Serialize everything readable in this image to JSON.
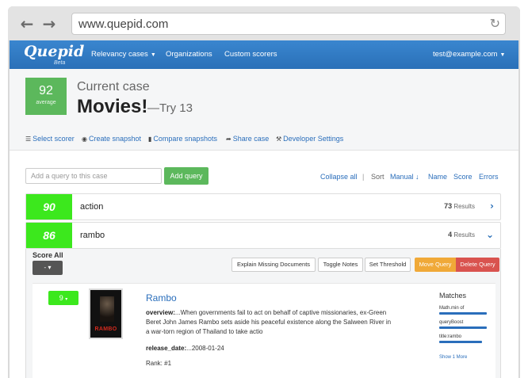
{
  "browser": {
    "url": "www.quepid.com",
    "back_icon": "←",
    "forward_icon": "→",
    "reload_icon": "↻"
  },
  "navbar": {
    "logo": "Quepid",
    "logo_sub": "Beta",
    "items": [
      {
        "label": "Relevancy cases",
        "dropdown": true
      },
      {
        "label": "Organizations",
        "dropdown": false
      },
      {
        "label": "Custom scorers",
        "dropdown": false
      }
    ],
    "user": "test@example.com"
  },
  "case": {
    "score": "92",
    "score_label": "average",
    "current_case_label": "Current case",
    "title": "Movies!",
    "try_label": "—Try 13",
    "actions": [
      {
        "label": "Select scorer",
        "icon": "list-icon"
      },
      {
        "label": "Create snapshot",
        "icon": "camera-icon"
      },
      {
        "label": "Compare snapshots",
        "icon": "bar-chart-icon"
      },
      {
        "label": "Share case",
        "icon": "share-icon"
      },
      {
        "label": "Developer Settings",
        "icon": "wrench-icon"
      }
    ]
  },
  "query_bar": {
    "placeholder": "Add a query to this case",
    "add_label": "Add query",
    "collapse_all": "Collapse all",
    "sort_label": "Sort",
    "sort_options": [
      "Manual",
      "Name",
      "Score",
      "Errors"
    ]
  },
  "queries": [
    {
      "score": "90",
      "label": "action",
      "count": "73",
      "results_label": "Results",
      "expanded": false
    },
    {
      "score": "86",
      "label": "rambo",
      "count": "4",
      "results_label": "Results",
      "expanded": true
    }
  ],
  "query_detail": {
    "score_all_label": "Score All",
    "score_all_value": "-",
    "buttons": {
      "explain": "Explain Missing Documents",
      "toggle_notes": "Toggle Notes",
      "set_threshold": "Set Threshold",
      "move_query": "Move Query",
      "delete_query": "Delete Query"
    },
    "doc": {
      "score": "9",
      "title": "Rambo",
      "poster_text": "RAMBO",
      "overview_label": "overview:",
      "overview": "...When governments fail to act on behalf of captive missionaries, ex-Green Beret John James Rambo sets aside his peaceful existence along the Salween River in a war-torn region of Thailand to take actio",
      "release_label": "release_date:",
      "release": "...2008-01-24",
      "rank": "Rank: #1",
      "matches_title": "Matches",
      "matches": [
        {
          "label": "Math.min of",
          "fill": 1.0
        },
        {
          "label": "queryBoost",
          "fill": 1.0
        },
        {
          "label": "title:rambo",
          "fill": 0.9
        }
      ],
      "show_more": "Show 1 More"
    }
  },
  "colors": {
    "navbar": "#2a70b8",
    "score_green": "#3ce81d",
    "avg_green": "#5cb85c",
    "orange": "#f0a938",
    "red": "#d9534f",
    "link": "#2a6ebb"
  }
}
